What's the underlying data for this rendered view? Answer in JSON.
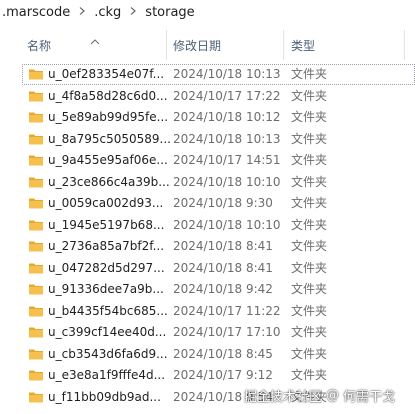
{
  "breadcrumb": {
    "items": [
      ".marscode",
      ".ckg",
      "storage"
    ]
  },
  "columns": {
    "name": "名称",
    "date": "修改日期",
    "type": "类型"
  },
  "colors": {
    "folder_body": "#f5c04d",
    "folder_tab": "#e6a92f",
    "header_text": "#4c607a",
    "meta_text": "#6d6d6d"
  },
  "files": [
    {
      "name": "u_0ef283354e07f...",
      "date": "2024/10/18 10:13",
      "type": "文件夹"
    },
    {
      "name": "u_4f8a58d28c6d0...",
      "date": "2024/10/17 17:22",
      "type": "文件夹"
    },
    {
      "name": "u_5e89ab99d95fe...",
      "date": "2024/10/18 10:12",
      "type": "文件夹"
    },
    {
      "name": "u_8a795c5050589...",
      "date": "2024/10/18 10:13",
      "type": "文件夹"
    },
    {
      "name": "u_9a455e95af06e...",
      "date": "2024/10/17 14:51",
      "type": "文件夹"
    },
    {
      "name": "u_23ce866c4a39b...",
      "date": "2024/10/18 10:10",
      "type": "文件夹"
    },
    {
      "name": "u_0059ca002d93...",
      "date": "2024/10/18 9:30",
      "type": "文件夹"
    },
    {
      "name": "u_1945e5197b68...",
      "date": "2024/10/18 10:10",
      "type": "文件夹"
    },
    {
      "name": "u_2736a85a7bf2f...",
      "date": "2024/10/18 8:41",
      "type": "文件夹"
    },
    {
      "name": "u_047282d5d297...",
      "date": "2024/10/18 8:41",
      "type": "文件夹"
    },
    {
      "name": "u_91336dee7a9b...",
      "date": "2024/10/18 9:42",
      "type": "文件夹"
    },
    {
      "name": "u_b4435f54bc685...",
      "date": "2024/10/17 11:22",
      "type": "文件夹"
    },
    {
      "name": "u_c399cf14ee40d...",
      "date": "2024/10/17 17:10",
      "type": "文件夹"
    },
    {
      "name": "u_cb3543d6fa6d9...",
      "date": "2024/10/18 8:45",
      "type": "文件夹"
    },
    {
      "name": "u_e3e8a1f9fffe4d...",
      "date": "2024/10/17 9:12",
      "type": "文件夹"
    },
    {
      "name": "u_f11bb09db9ad...",
      "date": "2024/10/18 9:54",
      "type": "文件夹"
    }
  ],
  "watermark": {
    "site": "掘金技术社区",
    "author": "何需干戈"
  }
}
